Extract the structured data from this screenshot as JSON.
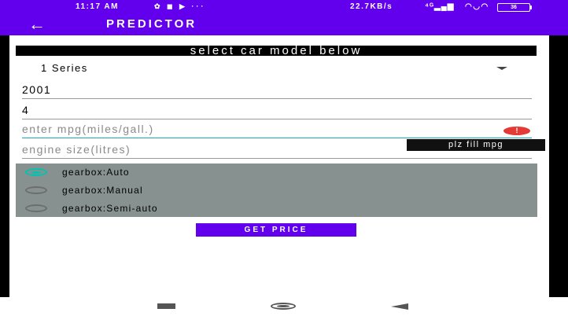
{
  "status_bar": {
    "time": "11:17 AM",
    "notification_icons": "✿ ◼ ▶ ···",
    "network_speed": "22.7KB/s",
    "signal": "⁴ᴳ▂▄▆",
    "wifi": "◠◡◠",
    "battery": "36"
  },
  "app_bar": {
    "back_icon": "←",
    "title": "PREDICTOR"
  },
  "form": {
    "banner": "select car model below",
    "model_spinner": {
      "selected": "1 Series"
    },
    "year_field": {
      "value": "2001"
    },
    "fourth_field": {
      "value": "4"
    },
    "mpg_field": {
      "placeholder": "enter mpg(miles/gall.)",
      "error_icon": "!",
      "error_message": "plz fill mpg"
    },
    "engine_field": {
      "placeholder": "engine size(litres)"
    },
    "gearbox": {
      "options": [
        {
          "label": "gearbox:Auto",
          "checked": true
        },
        {
          "label": "gearbox:Manual",
          "checked": false
        },
        {
          "label": "gearbox:Semi-auto",
          "checked": false
        }
      ]
    },
    "get_price_label": "GET PRICE"
  },
  "colors": {
    "primary": "#6200ee",
    "radio_group_bg": "#879290",
    "radio_accent": "#00c4b0",
    "error": "#e53935",
    "field_focus": "#1ea7b8"
  },
  "icons": {
    "back": "arrow-left-icon",
    "spinner": "dropdown-arrow-icon",
    "error": "error-icon",
    "nav_recent": "recent-apps-icon",
    "nav_home": "home-icon",
    "nav_back": "back-triangle-icon"
  }
}
